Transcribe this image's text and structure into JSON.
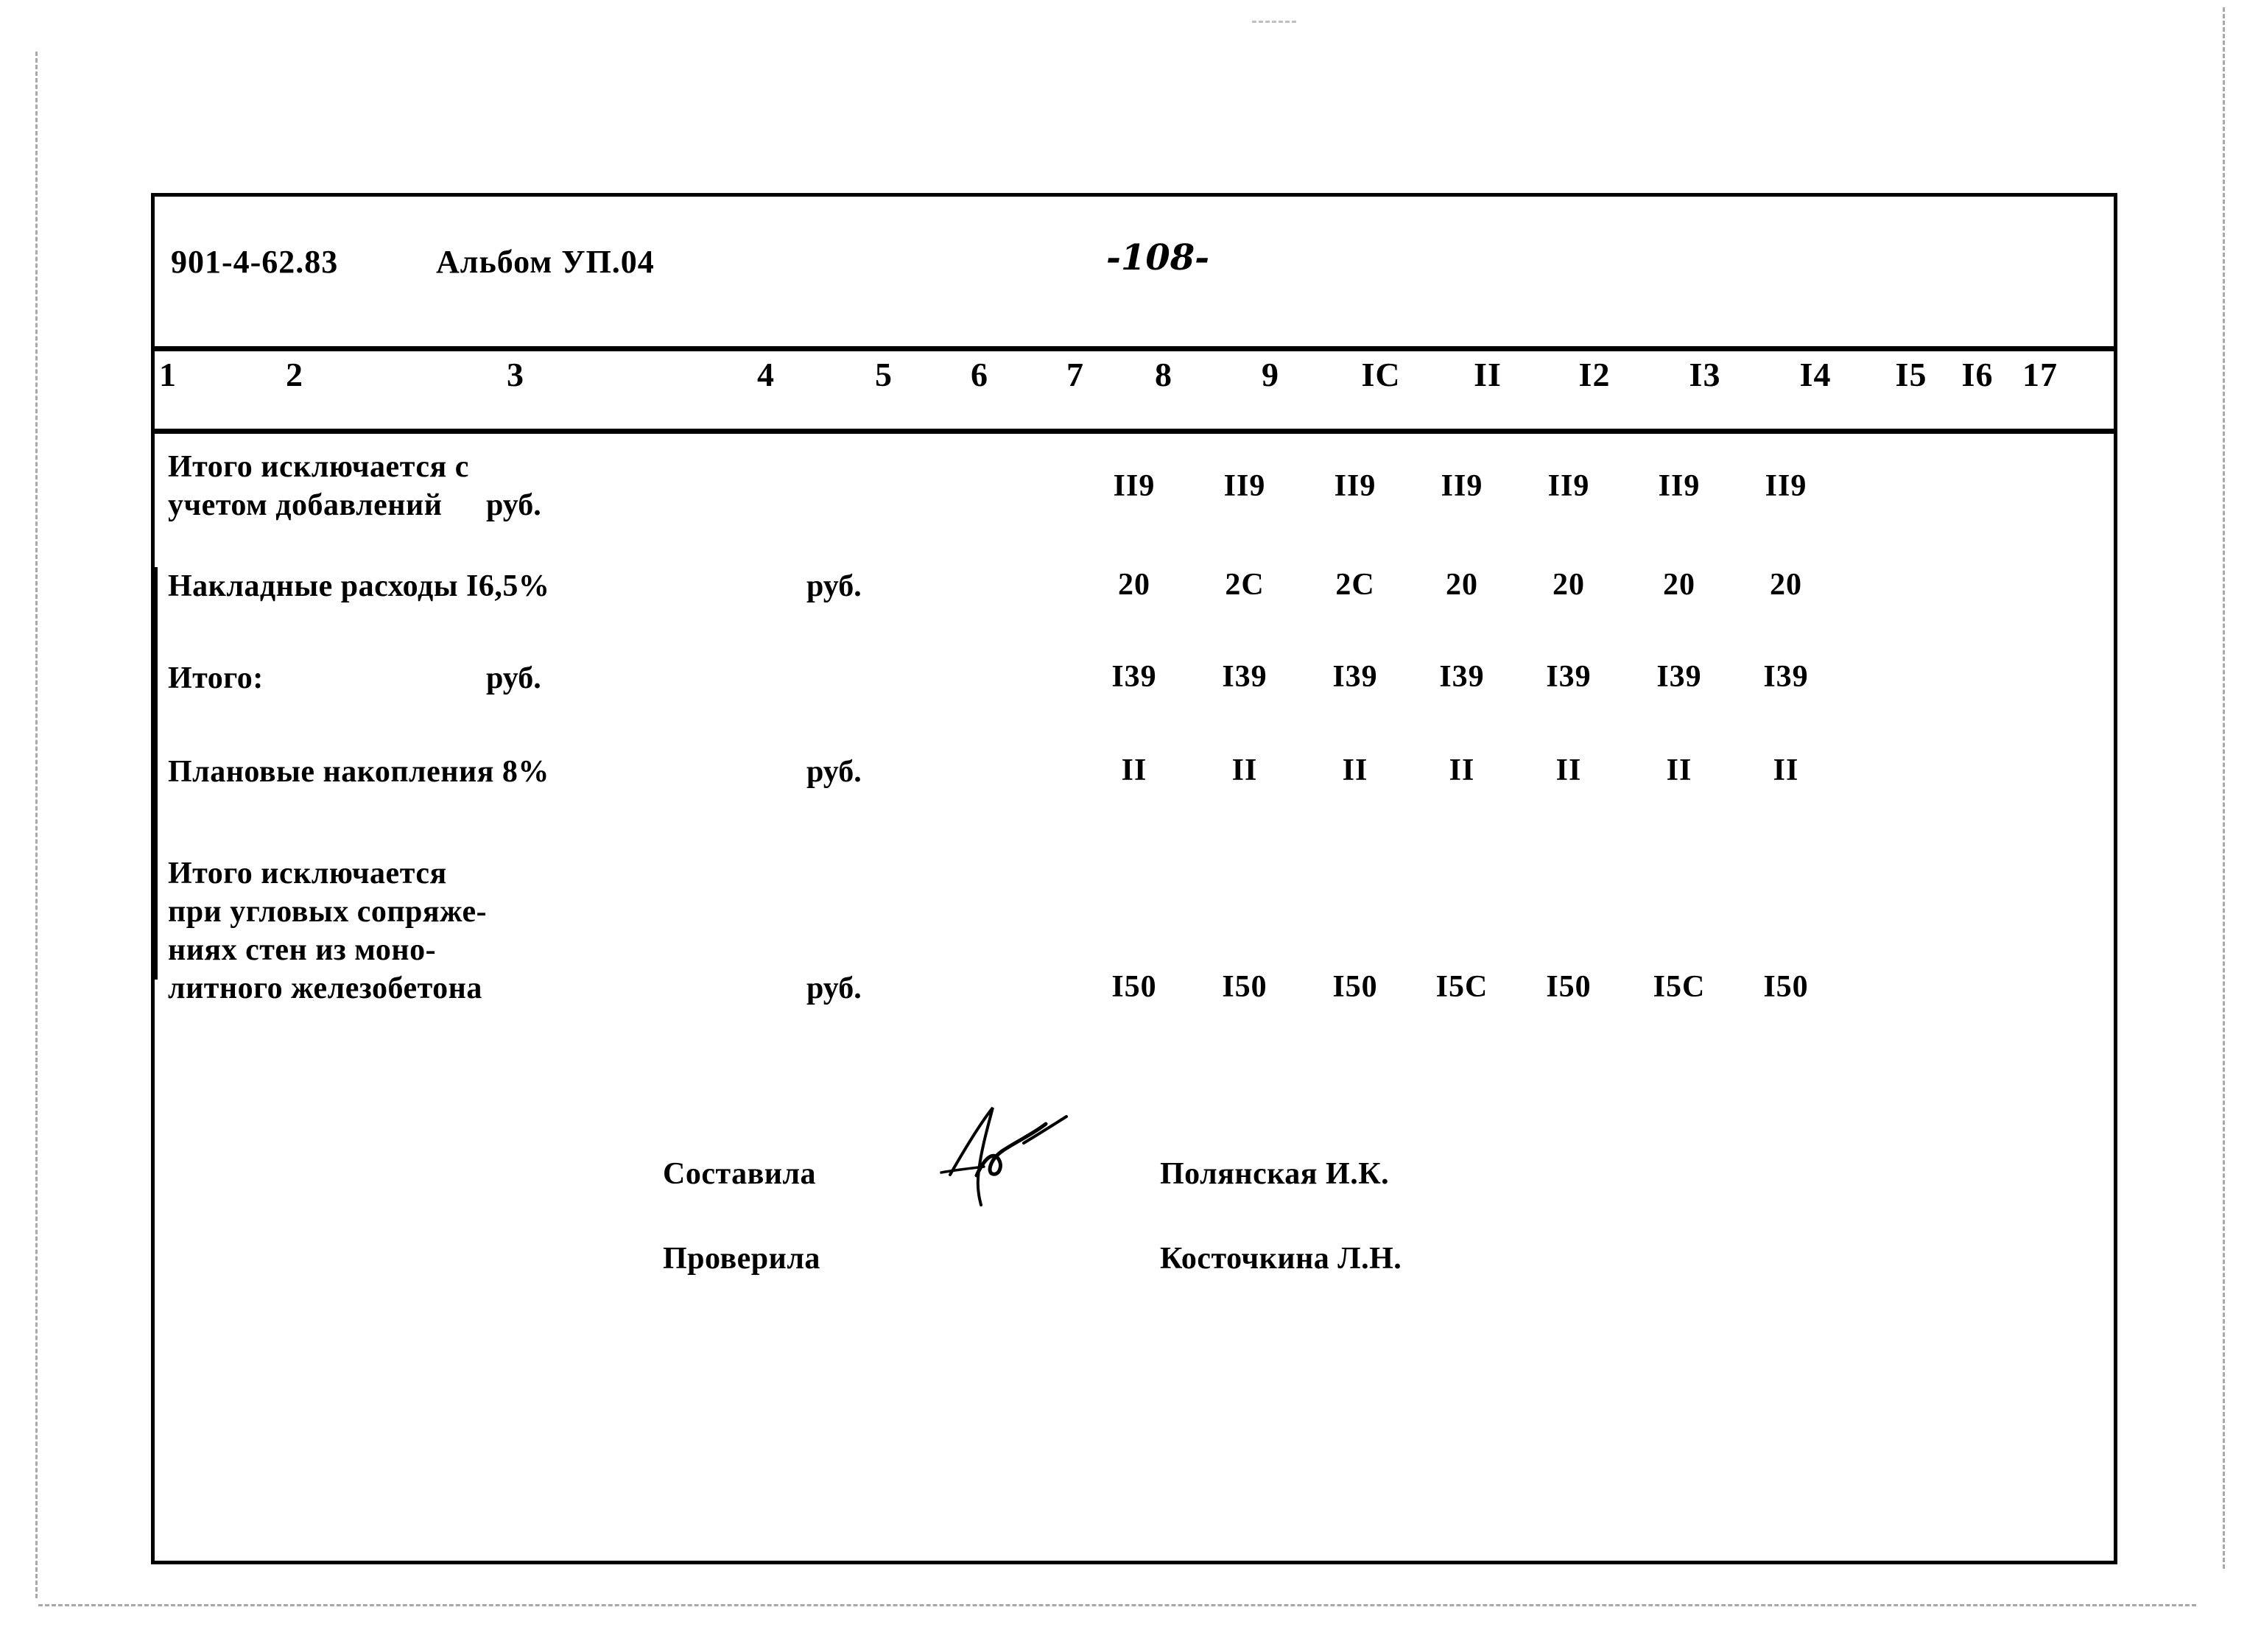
{
  "page": {
    "header": {
      "project_code": "901-4-62.83",
      "album": "Альбом УП.04",
      "page_number": "-108-"
    }
  },
  "table": {
    "column_headers": [
      "1",
      "2",
      "3",
      "4",
      "5",
      "6",
      "7",
      "8",
      "9",
      "IC",
      "II",
      "I2",
      "I3",
      "I4",
      "I5",
      "I6",
      "17"
    ],
    "rows": [
      {
        "label_lines": [
          "Итого исключается с",
          "учетом добавлений"
        ],
        "unit": "руб.",
        "values": [
          "II9",
          "II9",
          "II9",
          "II9",
          "II9",
          "II9",
          "II9"
        ]
      },
      {
        "label_lines": [
          "Накладные расходы I6,5%"
        ],
        "unit": "руб.",
        "values": [
          "20",
          "2C",
          "2C",
          "20",
          "20",
          "20",
          "20"
        ]
      },
      {
        "label_lines": [
          "Итого:"
        ],
        "unit": "руб.",
        "values": [
          "I39",
          "I39",
          "I39",
          "I39",
          "I39",
          "I39",
          "I39"
        ]
      },
      {
        "label_lines": [
          "Плановые накопления 8%"
        ],
        "unit": "руб.",
        "values": [
          "II",
          "II",
          "II",
          "II",
          "II",
          "II",
          "II"
        ]
      },
      {
        "label_lines": [
          "Итого исключается",
          "при угловых сопряже-",
          "ниях стен из моно-",
          "литного железобетона"
        ],
        "unit": "руб.",
        "values": [
          "I50",
          "I50",
          "I50",
          "I5C",
          "I50",
          "I5C",
          "I50"
        ]
      }
    ]
  },
  "signatures": {
    "rows": [
      {
        "role": "Составила",
        "name": "Полянская И.К."
      },
      {
        "role": "Проверила",
        "name": "Косточкина Л.Н."
      }
    ]
  },
  "colors": {
    "ink": "#000000",
    "paper": "#ffffff",
    "scan_edge": "#8d8d8d"
  }
}
